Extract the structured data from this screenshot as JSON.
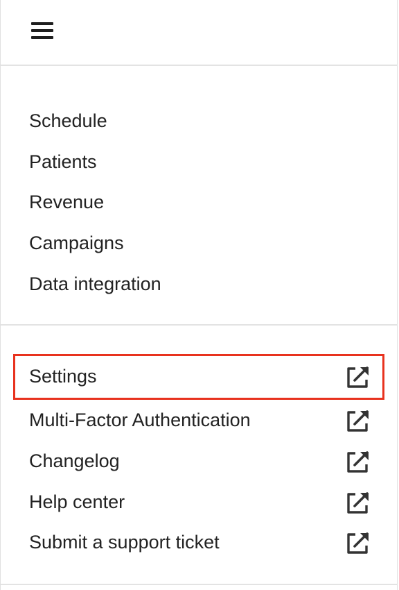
{
  "header": {
    "menu_icon": "hamburger-menu-icon"
  },
  "nav": {
    "items": [
      {
        "label": "Schedule"
      },
      {
        "label": "Patients"
      },
      {
        "label": "Revenue"
      },
      {
        "label": "Campaigns"
      },
      {
        "label": "Data integration"
      }
    ]
  },
  "external_links": {
    "icon": "external-link-icon",
    "highlight_color": "#e8321e",
    "items": [
      {
        "label": "Settings",
        "highlighted": true
      },
      {
        "label": "Multi-Factor Authentication",
        "highlighted": false
      },
      {
        "label": "Changelog",
        "highlighted": false
      },
      {
        "label": "Help center",
        "highlighted": false
      },
      {
        "label": "Submit a support ticket",
        "highlighted": false
      }
    ]
  }
}
